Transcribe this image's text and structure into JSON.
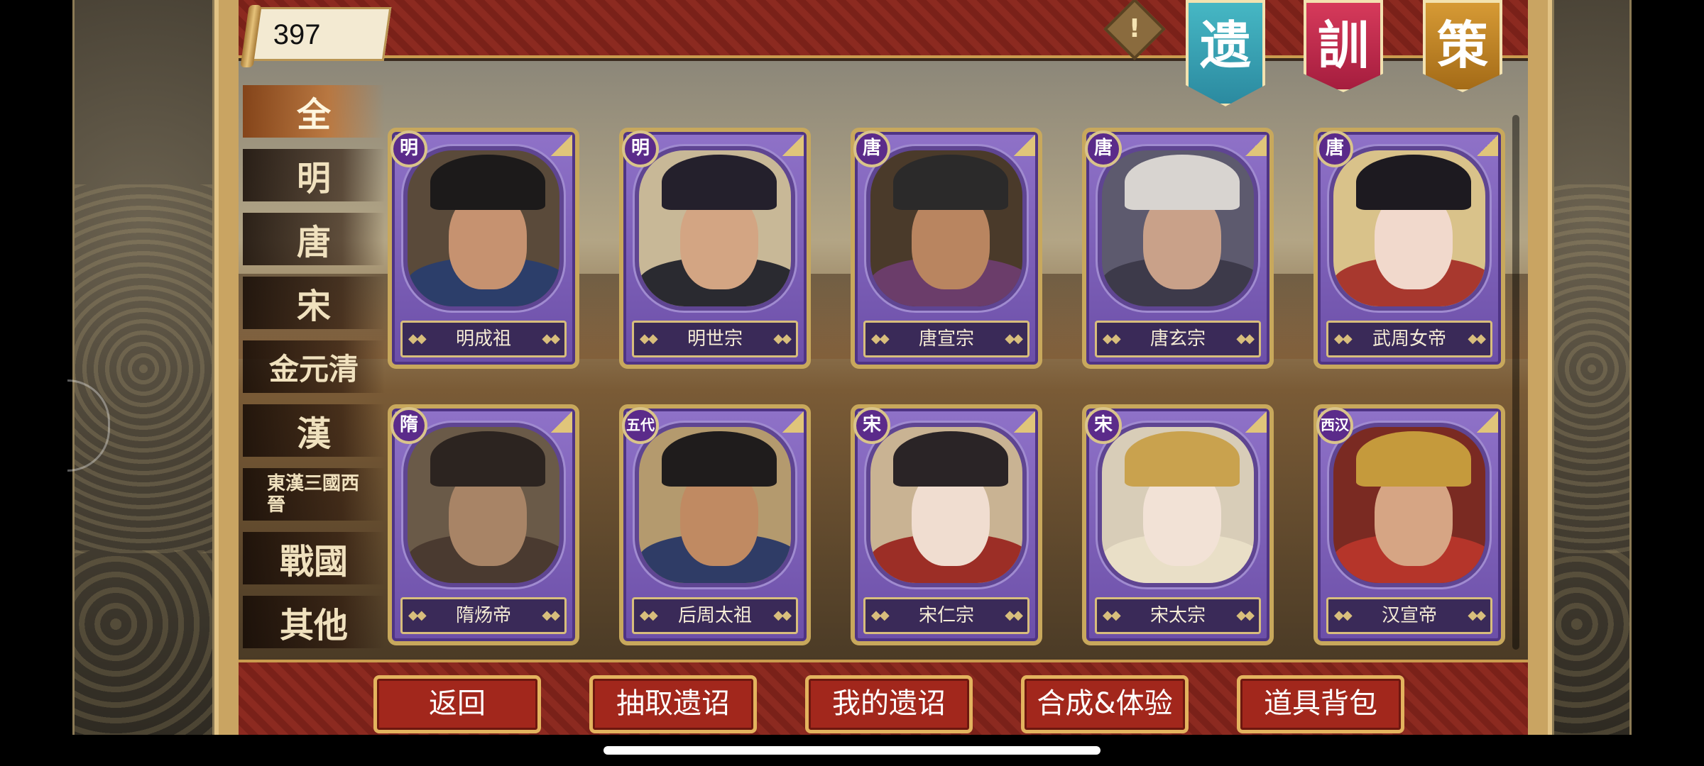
{
  "top_bar": {
    "counter_value": "397",
    "alert_icon": "exclamation-diamond-icon",
    "banners": [
      {
        "label": "遗",
        "color": "#3aa3b5"
      },
      {
        "label": "訓",
        "color": "#c42a4c"
      },
      {
        "label": "策",
        "color": "#c28526"
      }
    ]
  },
  "categories": [
    {
      "label": "全",
      "active": true
    },
    {
      "label": "明"
    },
    {
      "label": "唐"
    },
    {
      "label": "宋"
    },
    {
      "label": "金元清"
    },
    {
      "label": "漢"
    },
    {
      "label": "東漢三國西晉"
    },
    {
      "label": "戰國"
    },
    {
      "label": "其他"
    }
  ],
  "cards": [
    {
      "era": "明",
      "name": "明成祖"
    },
    {
      "era": "明",
      "name": "明世宗"
    },
    {
      "era": "唐",
      "name": "唐宣宗"
    },
    {
      "era": "唐",
      "name": "唐玄宗"
    },
    {
      "era": "唐",
      "name": "武周女帝"
    },
    {
      "era": "隋",
      "name": "隋炀帝"
    },
    {
      "era": "五代",
      "name": "后周太祖"
    },
    {
      "era": "宋",
      "name": "宋仁宗"
    },
    {
      "era": "宋",
      "name": "宋太宗"
    },
    {
      "era": "西汉",
      "name": "汉宣帝"
    }
  ],
  "bottom_buttons": [
    {
      "label": "返回"
    },
    {
      "label": "抽取遗诏"
    },
    {
      "label": "我的遗诏"
    },
    {
      "label": "合成&体验"
    },
    {
      "label": "道具背包"
    }
  ],
  "colors": {
    "card_purple": "#7a5cb8",
    "frame_gold": "#c9a462",
    "bar_red": "#8c2a20"
  }
}
